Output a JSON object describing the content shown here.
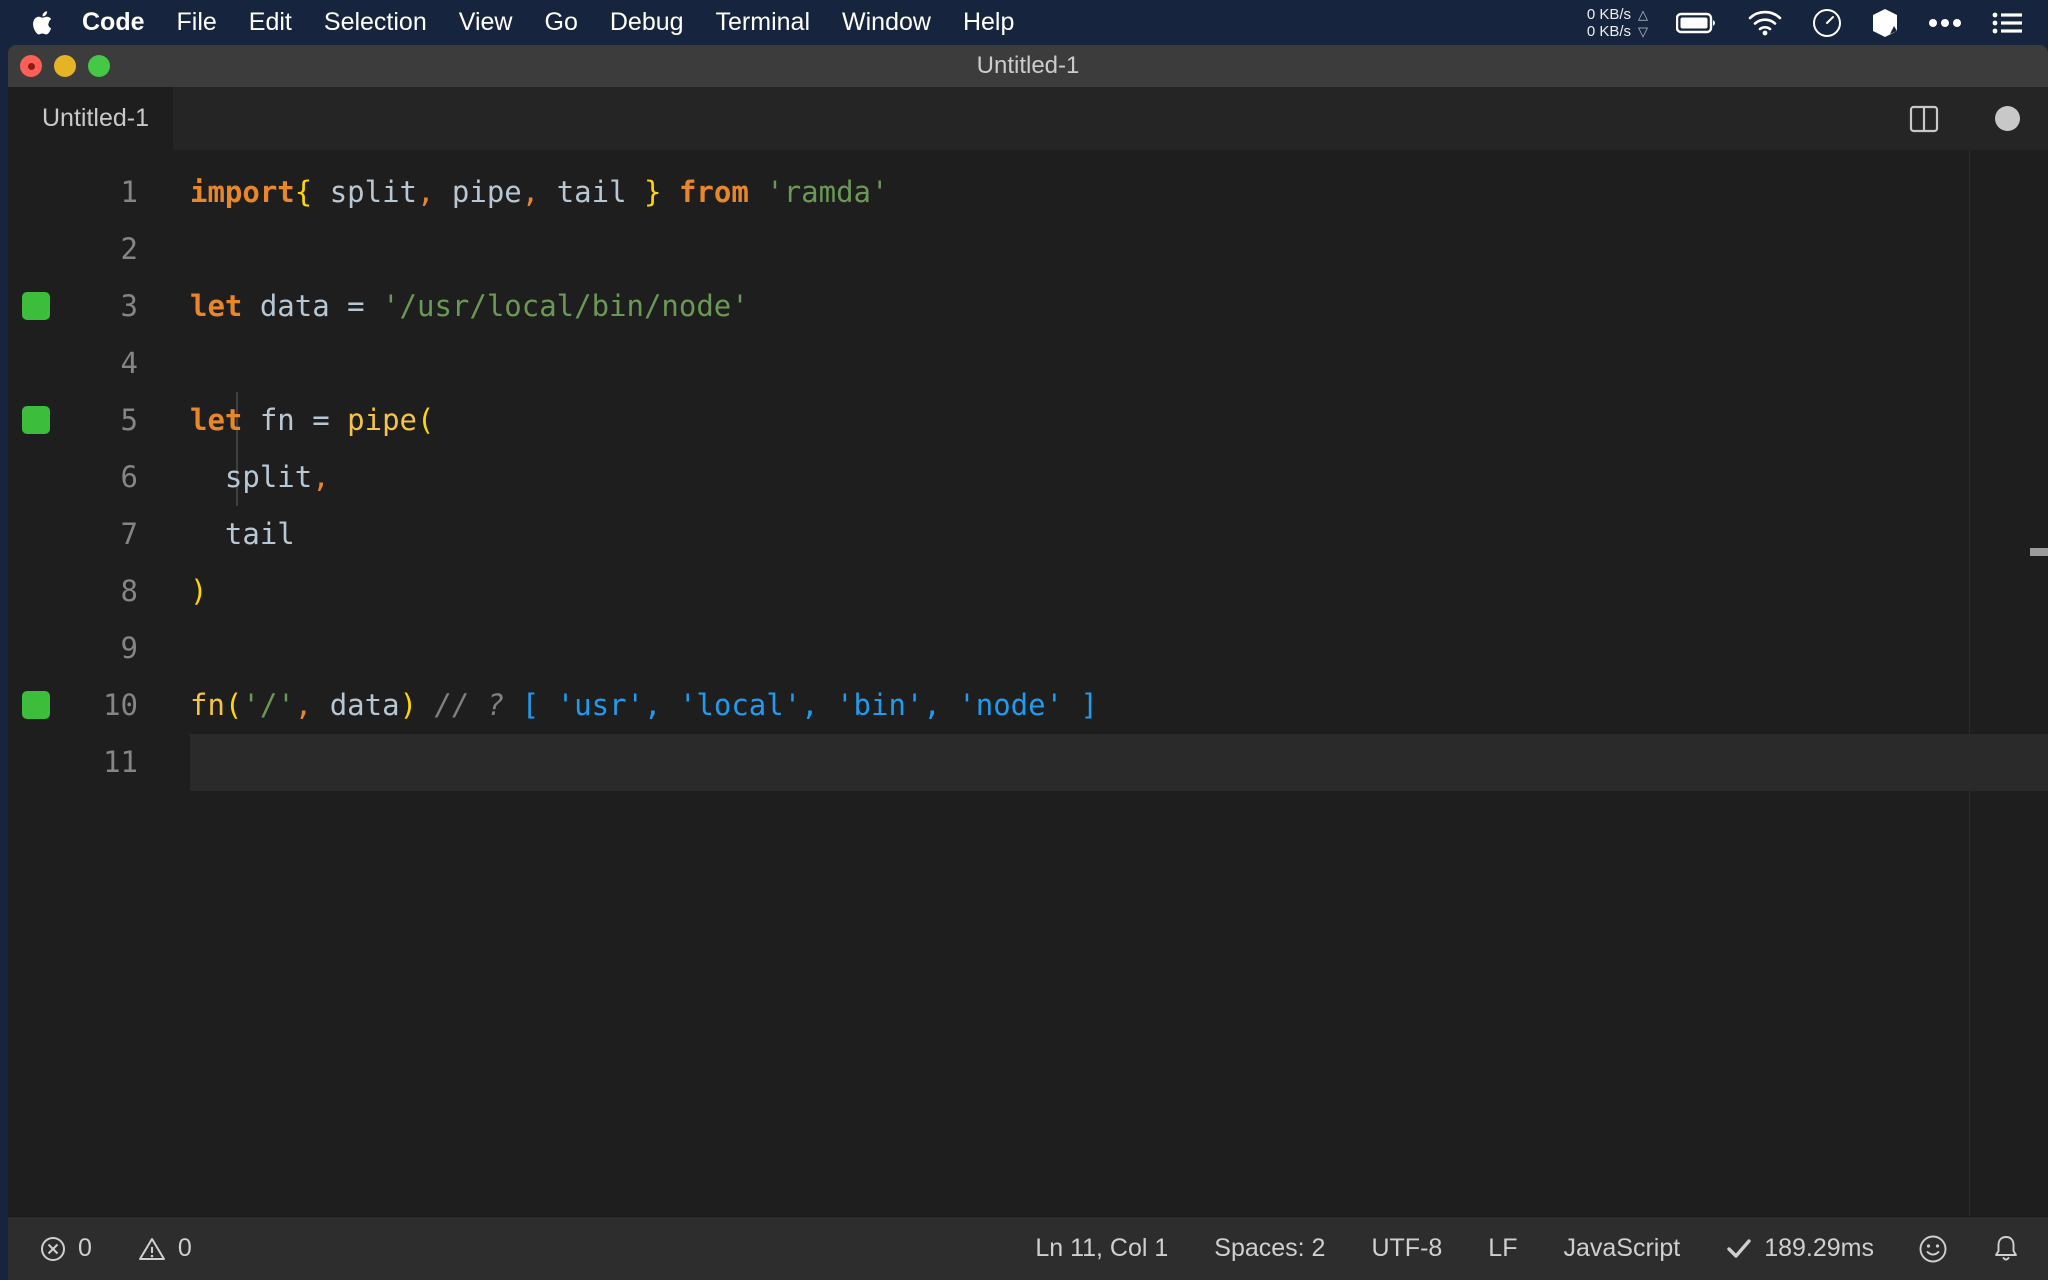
{
  "menubar": {
    "apple_icon": "apple-logo-icon",
    "items": [
      {
        "label": "Code",
        "bold": true
      },
      {
        "label": "File",
        "bold": false
      },
      {
        "label": "Edit",
        "bold": false
      },
      {
        "label": "Selection",
        "bold": false
      },
      {
        "label": "View",
        "bold": false
      },
      {
        "label": "Go",
        "bold": false
      },
      {
        "label": "Debug",
        "bold": false
      },
      {
        "label": "Terminal",
        "bold": false
      },
      {
        "label": "Window",
        "bold": false
      },
      {
        "label": "Help",
        "bold": false
      }
    ],
    "network": {
      "upload": "0 KB/s",
      "download": "0 KB/s",
      "up_arrow": "triangle-up-icon",
      "down_arrow": "triangle-down-icon"
    },
    "status_icons": [
      "battery-icon",
      "wifi-icon",
      "clock-gauge-icon",
      "cube-icon",
      "ellipsis-icon",
      "list-menu-icon"
    ]
  },
  "window": {
    "title": "Untitled-1",
    "traffic_lights": [
      "close-button",
      "minimize-button",
      "zoom-button"
    ]
  },
  "tabbar": {
    "tabs": [
      {
        "label": "Untitled-1",
        "active": true
      }
    ],
    "actions": [
      "split-editor-icon",
      "unsaved-indicator-dot"
    ]
  },
  "editor": {
    "language": "JavaScript",
    "current_line": 11,
    "lines": [
      {
        "number": "1",
        "git": false,
        "current": false
      },
      {
        "number": "2",
        "git": false,
        "current": false
      },
      {
        "number": "3",
        "git": true,
        "current": false
      },
      {
        "number": "4",
        "git": false,
        "current": false
      },
      {
        "number": "5",
        "git": true,
        "current": false
      },
      {
        "number": "6",
        "git": false,
        "current": false
      },
      {
        "number": "7",
        "git": false,
        "current": false
      },
      {
        "number": "8",
        "git": false,
        "current": false
      },
      {
        "number": "9",
        "git": false,
        "current": false
      },
      {
        "number": "10",
        "git": true,
        "current": false
      },
      {
        "number": "11",
        "git": false,
        "current": true
      }
    ],
    "code": {
      "l1_import": "import",
      "l1_brace_open": "{",
      "l1_split": " split",
      "l1_comma1": ",",
      "l1_pipe": " pipe",
      "l1_comma2": ",",
      "l1_tail": " tail ",
      "l1_brace_close": "}",
      "l1_from": " from ",
      "l1_module": "'ramda'",
      "l3_let": "let",
      "l3_name": " data ",
      "l3_eq": "= ",
      "l3_value": "'/usr/local/bin/node'",
      "l5_let": "let",
      "l5_name": " fn ",
      "l5_eq": "= ",
      "l5_fn": "pipe",
      "l5_paren": "(",
      "l6_arg": "  split",
      "l6_comma": ",",
      "l7_arg": "  tail",
      "l8_paren": ")",
      "l10_fn": "fn",
      "l10_paren_open": "(",
      "l10_sep": "'/'",
      "l10_comma": ",",
      "l10_arg": " data",
      "l10_paren_close": ")",
      "l10_comment": " // ?",
      "l10_result": " [ 'usr', 'local', 'bin', 'node' ]"
    }
  },
  "statusbar": {
    "errors_icon": "error-circle-icon",
    "errors_count": "0",
    "warnings_icon": "warning-triangle-icon",
    "warnings_count": "0",
    "cursor_position": "Ln 11, Col 1",
    "indentation": "Spaces: 2",
    "encoding": "UTF-8",
    "line_ending": "LF",
    "language_mode": "JavaScript",
    "run_check_icon": "checkmark-icon",
    "run_time": "189.29ms",
    "feedback_icon": "smiley-icon",
    "notifications_icon": "bell-icon"
  },
  "colors": {
    "menubar_bg": "#16253d",
    "titlebar_bg": "#3c3c3c",
    "tabbar_bg": "#252526",
    "editor_bg": "#1e1e1e",
    "statusbar_bg": "#2d2d2d",
    "keyword": "#e8862a",
    "brace": "#ffd602",
    "string": "#6a9955",
    "function": "#f6c344",
    "identifier": "#b8c7d4",
    "comment": "#808080",
    "inline_value": "#1f9cf0",
    "git_added": "#3cbd3c"
  }
}
